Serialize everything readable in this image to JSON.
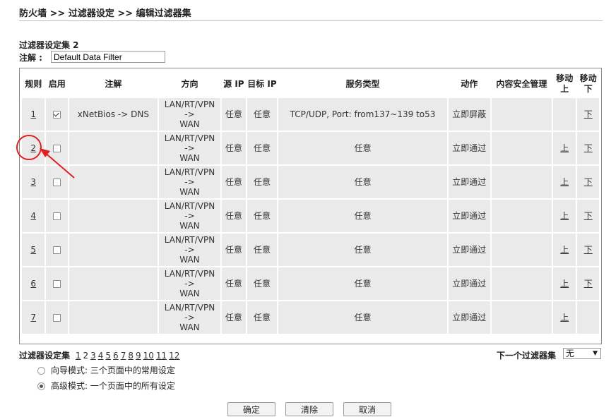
{
  "breadcrumb": "防火墙 >> 过滤器设定 >> 编辑过滤器集",
  "filter_set": {
    "title": "过滤器设定集 2",
    "note_label": "注解 :",
    "note_value": "Default Data Filter"
  },
  "table": {
    "headers": {
      "rule": "规则",
      "enable": "启用",
      "note": "注解",
      "direction": "方向",
      "src_ip": "源 IP",
      "dst_ip": "目标 IP",
      "service": "服务类型",
      "action": "动作",
      "content_security": "内容安全管理",
      "move_up": "移动上",
      "move_down": "移动下"
    },
    "rows": [
      {
        "rule": "1",
        "enabled": true,
        "note": "xNetBios -> DNS",
        "dir1": "LAN/RT/VPN",
        "dir2": "->",
        "dir3": "WAN",
        "src": "任意",
        "dst": "任意",
        "service": "TCP/UDP, Port: from137~139 to53",
        "action": "立即屏蔽",
        "up": "",
        "down": "下"
      },
      {
        "rule": "2",
        "enabled": false,
        "note": "",
        "dir1": "LAN/RT/VPN",
        "dir2": "->",
        "dir3": "WAN",
        "src": "任意",
        "dst": "任意",
        "service": "任意",
        "action": "立即通过",
        "up": "上",
        "down": "下"
      },
      {
        "rule": "3",
        "enabled": false,
        "note": "",
        "dir1": "LAN/RT/VPN",
        "dir2": "->",
        "dir3": "WAN",
        "src": "任意",
        "dst": "任意",
        "service": "任意",
        "action": "立即通过",
        "up": "上",
        "down": "下"
      },
      {
        "rule": "4",
        "enabled": false,
        "note": "",
        "dir1": "LAN/RT/VPN",
        "dir2": "->",
        "dir3": "WAN",
        "src": "任意",
        "dst": "任意",
        "service": "任意",
        "action": "立即通过",
        "up": "上",
        "down": "下"
      },
      {
        "rule": "5",
        "enabled": false,
        "note": "",
        "dir1": "LAN/RT/VPN",
        "dir2": "->",
        "dir3": "WAN",
        "src": "任意",
        "dst": "任意",
        "service": "任意",
        "action": "立即通过",
        "up": "上",
        "down": "下"
      },
      {
        "rule": "6",
        "enabled": false,
        "note": "",
        "dir1": "LAN/RT/VPN",
        "dir2": "->",
        "dir3": "WAN",
        "src": "任意",
        "dst": "任意",
        "service": "任意",
        "action": "立即通过",
        "up": "上",
        "down": "下"
      },
      {
        "rule": "7",
        "enabled": false,
        "note": "",
        "dir1": "LAN/RT/VPN",
        "dir2": "->",
        "dir3": "WAN",
        "src": "任意",
        "dst": "任意",
        "service": "任意",
        "action": "立即通过",
        "up": "上",
        "down": ""
      }
    ]
  },
  "pager": {
    "label": "过滤器设定集",
    "pages": [
      "1",
      "2",
      "3",
      "4",
      "5",
      "6",
      "7",
      "8",
      "9",
      "10",
      "11",
      "12"
    ],
    "current": "2"
  },
  "next_set": {
    "label": "下一个过滤器集",
    "selected": "无"
  },
  "modes": [
    {
      "label": "向导模式: 三个页面中的常用设定",
      "selected": false
    },
    {
      "label": "高级模式: 一个页面中的所有设定",
      "selected": true
    }
  ],
  "buttons": {
    "ok": "确定",
    "clear": "清除",
    "cancel": "取消"
  },
  "colors": {
    "annotation": "#e02020",
    "cell_bg": "#eaeaea"
  }
}
